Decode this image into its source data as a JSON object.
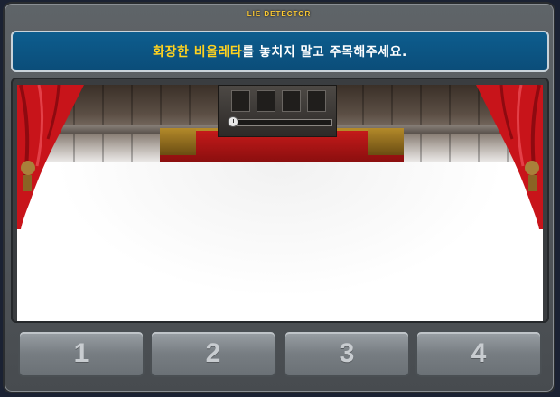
{
  "window": {
    "title": "LIE DETECTOR"
  },
  "instruction": {
    "highlight": "화장한 비올레타",
    "rest": "를 놓치지 말고 주목해주세요."
  },
  "timer": {
    "slots": 4,
    "remaining_fraction": 0.0
  },
  "answers": [
    {
      "label": "1"
    },
    {
      "label": "2"
    },
    {
      "label": "3"
    },
    {
      "label": "4"
    }
  ],
  "colors": {
    "banner_bg": "#0b4d79",
    "highlight_text": "#ffd21f",
    "title_text": "#ffcc33",
    "curtain": "#c8141a"
  },
  "icons": {
    "timer": "clock-icon",
    "curtains": "curtain-icon"
  }
}
